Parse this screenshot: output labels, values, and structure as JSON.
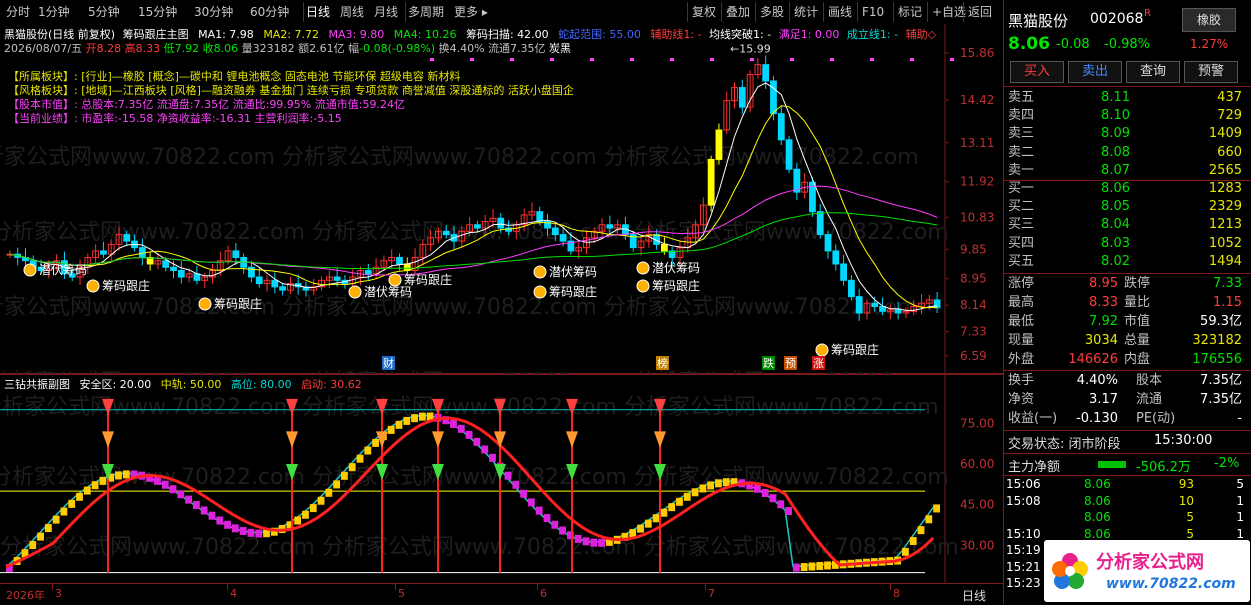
{
  "toolbar": {
    "periods": [
      "分时",
      "1分钟",
      "5分钟",
      "15分钟",
      "30分钟",
      "60分钟",
      "日线",
      "周线",
      "月线",
      "多周期",
      "更多 ▸"
    ],
    "active_period": "日线",
    "right_buttons": [
      "复权",
      "叠加",
      "多股",
      "统计",
      "画线",
      "F10",
      "标记",
      "+自选",
      "返回"
    ]
  },
  "main": {
    "title": "黑猫股份(日线 前复权)",
    "indicator_name": "筹码跟庄主图",
    "ma1": "MA1: 7.98",
    "ma2": "MA2: 7.72",
    "ma3": "MA3: 9.80",
    "ma4": "MA4: 10.26",
    "scan": "筹码扫描: 42.00",
    "range": "蛇起范围: 55.00",
    "aux1": "辅助线1: -",
    "trend": "均线突破1: -",
    "full": "满足1: 0.00",
    "done": "成立线1: -",
    "aux2": "辅助◇",
    "date": "2026/08/07/五",
    "open_lbl": "开",
    "open": "8.28",
    "high_lbl": "高",
    "high": "8.33",
    "low_lbl": "低",
    "low": "7.92",
    "close_lbl": "收",
    "close": "8.06",
    "vol_lbl": "量",
    "vol": "323182",
    "amt_lbl": "额",
    "amt": "2.61亿",
    "chg_lbl": "幅",
    "chg": "-0.08(-0.98%)",
    "turn_lbl": "换",
    "turn": "4.40%",
    "float_lbl": "流通",
    "float": "7.35亿",
    "tag": "炭黑",
    "blocks": [
      {
        "k": "【所属板块】:",
        "v": "[行业]—橡胶 [概念]—碳中和 锂电池概念 固态电池 节能环保 超级电容 新材料"
      },
      {
        "k": "【风格板块】:",
        "v": "[地域]—江西板块 [风格]—融资融券 基金独门 连续亏损 专项贷款 商誉减值 深股通标的 活跃小盘国企"
      },
      {
        "k": "【股本市值】:",
        "v": "总股本:7.35亿 流通盘:7.35亿 流通比:99.95% 流通市值:59.24亿"
      },
      {
        "k": "【当前业绩】:",
        "v": "市盈率:-15.58 净资收益率:-16.31 主营利润率:-5.15"
      }
    ],
    "price_ticks": [
      "15.86",
      "14.42",
      "13.11",
      "11.92",
      "10.83",
      "9.85",
      "8.95",
      "8.14",
      "7.33",
      "6.59"
    ],
    "peak_label": "15.99",
    "markers": [
      "潜伏筹码",
      "筹码跟庄",
      "筹码跟庄",
      "潜伏筹码",
      "筹码跟庄",
      "潜伏筹码",
      "筹码跟庄",
      "潜伏筹码",
      "筹码跟庄",
      "筹码跟庄"
    ],
    "event_tags": [
      "财",
      "榜",
      "跌",
      "预",
      "涨"
    ]
  },
  "sub": {
    "title": "三钻共振副图",
    "safe": "安全区: 20.00",
    "mid": "中轨: 50.00",
    "high": "高位: 80.00",
    "start": "启动: 30.62",
    "ticks": [
      "75.00",
      "60.00",
      "45.00",
      "30.00"
    ]
  },
  "xaxis": {
    "labels": [
      "2026年",
      "3",
      "4",
      "5",
      "6",
      "7",
      "8"
    ],
    "period": "日线"
  },
  "watermark": "分析家公式网www.70822.com",
  "panel": {
    "name": "黑猫股份",
    "code": "002068",
    "badge": "R",
    "sector_btn": "橡胶",
    "price": "8.06",
    "change": "-0.08",
    "pct": "-0.98%",
    "sector_pct": "1.27%",
    "buttons": [
      "买入",
      "卖出",
      "查询",
      "预警"
    ],
    "asks": [
      {
        "l": "卖五",
        "p": "8.11",
        "v": "437"
      },
      {
        "l": "卖四",
        "p": "8.10",
        "v": "729"
      },
      {
        "l": "卖三",
        "p": "8.09",
        "v": "1409"
      },
      {
        "l": "卖二",
        "p": "8.08",
        "v": "660"
      },
      {
        "l": "卖一",
        "p": "8.07",
        "v": "2565"
      }
    ],
    "bids": [
      {
        "l": "买一",
        "p": "8.06",
        "v": "1283"
      },
      {
        "l": "买二",
        "p": "8.05",
        "v": "2329"
      },
      {
        "l": "买三",
        "p": "8.04",
        "v": "1213"
      },
      {
        "l": "买四",
        "p": "8.03",
        "v": "1052"
      },
      {
        "l": "买五",
        "p": "8.02",
        "v": "1494"
      }
    ],
    "stats": [
      {
        "l1": "涨停",
        "v1": "8.95",
        "c1": "red",
        "l2": "跌停",
        "v2": "7.33",
        "c2": "green"
      },
      {
        "l1": "最高",
        "v1": "8.33",
        "c1": "red",
        "l2": "量比",
        "v2": "1.15",
        "c2": "red"
      },
      {
        "l1": "最低",
        "v1": "7.92",
        "c1": "green",
        "l2": "市值",
        "v2": "59.3亿",
        "c2": "white"
      },
      {
        "l1": "现量",
        "v1": "3034",
        "c1": "yellow",
        "l2": "总量",
        "v2": "323182",
        "c2": "yellow"
      },
      {
        "l1": "外盘",
        "v1": "146626",
        "c1": "red",
        "l2": "内盘",
        "v2": "176556",
        "c2": "green"
      }
    ],
    "fund": [
      {
        "l1": "换手",
        "v1": "4.40%",
        "l2": "股本",
        "v2": "7.35亿"
      },
      {
        "l1": "净资",
        "v1": "3.17",
        "l2": "流通",
        "v2": "7.35亿"
      },
      {
        "l1": "收益(一)",
        "v1": "-0.130",
        "l2": "PE(动)",
        "v2": "-"
      }
    ],
    "trade_state": "交易状态: 闭市阶段",
    "trade_time": "15:30:00",
    "flow_lbl": "主力净额",
    "flow_val": "-506.2万",
    "flow_pct": "-2%",
    "ticks": [
      {
        "t": "15:06",
        "p": "8.06",
        "v": "93",
        "n": "5"
      },
      {
        "t": "15:08",
        "p": "8.06",
        "v": "10",
        "n": "1"
      },
      {
        "t": "",
        "p": "8.06",
        "v": "5",
        "n": "1"
      },
      {
        "t": "15:10",
        "p": "8.06",
        "v": "5",
        "n": "1"
      },
      {
        "t": "15:19",
        "p": "",
        "v": "",
        "n": ""
      },
      {
        "t": "15:21",
        "p": "",
        "v": "",
        "n": ""
      },
      {
        "t": "15:23",
        "p": "",
        "v": "",
        "n": ""
      }
    ],
    "logo": "分析家公式网",
    "logo_url": "www.70822.com"
  },
  "chart_data": [
    {
      "type": "candlestick",
      "title": "黑猫股份(日线 前复权)",
      "y_ticks": [
        15.86,
        14.42,
        13.11,
        11.92,
        10.83,
        9.85,
        8.95,
        8.14,
        7.33,
        6.59
      ],
      "ylim": [
        6.4,
        16.5
      ],
      "x_labels": [
        "2026年",
        "3",
        "4",
        "5",
        "6",
        "7",
        "8"
      ],
      "close": [
        9.7,
        9.6,
        9.5,
        9.3,
        9.2,
        9.4,
        9.5,
        9.1,
        9.0,
        9.3,
        9.6,
        9.8,
        9.7,
        10.0,
        10.3,
        10.1,
        9.9,
        9.6,
        9.4,
        9.5,
        9.3,
        9.2,
        9.0,
        9.1,
        8.9,
        9.0,
        9.2,
        9.5,
        9.8,
        9.6,
        9.3,
        9.0,
        8.8,
        8.9,
        8.7,
        8.6,
        8.8,
        8.7,
        8.6,
        8.7,
        8.9,
        9.0,
        8.9,
        8.8,
        9.0,
        9.2,
        9.1,
        9.3,
        9.5,
        9.6,
        9.4,
        9.2,
        9.6,
        10.0,
        10.2,
        10.4,
        10.3,
        10.1,
        10.4,
        10.6,
        10.5,
        10.7,
        10.8,
        10.5,
        10.4,
        10.6,
        10.9,
        11.0,
        10.7,
        10.5,
        10.3,
        10.1,
        9.8,
        9.9,
        10.2,
        10.4,
        10.6,
        10.5,
        10.6,
        10.3,
        9.9,
        10.1,
        10.3,
        10.0,
        9.8,
        9.6,
        9.9,
        10.2,
        10.6,
        11.2,
        12.6,
        13.5,
        14.4,
        14.8,
        14.2,
        15.2,
        15.5,
        15.0,
        14.0,
        13.2,
        12.3,
        11.6,
        11.9,
        11.0,
        10.3,
        9.8,
        9.4,
        8.9,
        8.4,
        7.9,
        8.2,
        8.1,
        7.95,
        8.0,
        7.9,
        7.95,
        8.1,
        8.2,
        8.3,
        8.06
      ]
    },
    {
      "type": "line",
      "title": "三钻共振副图",
      "y_ticks": [
        75,
        60,
        45,
        30
      ],
      "ylim": [
        18,
        88
      ],
      "safe": 20,
      "mid": 50,
      "high": 80,
      "start": 30.62
    }
  ]
}
